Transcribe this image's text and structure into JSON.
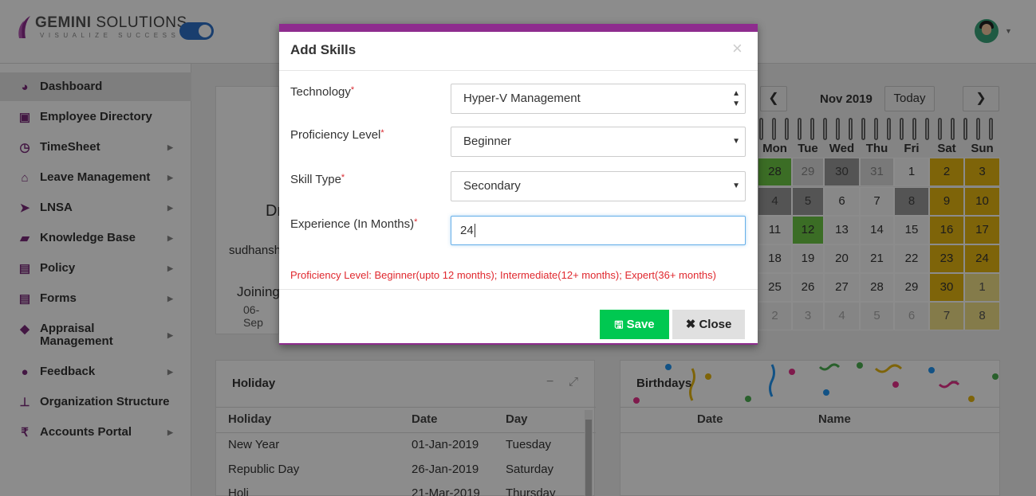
{
  "brand": {
    "name_bold": "GEMINI",
    "name_rest": " SOLUTIONS",
    "tagline": "VISUALIZE SUCCESS"
  },
  "sidebar": {
    "items": [
      {
        "label": "Dashboard",
        "icon": "dashboard-icon"
      },
      {
        "label": "Employee Directory",
        "icon": "contact-book-icon"
      },
      {
        "label": "TimeSheet",
        "icon": "clock-icon"
      },
      {
        "label": "Leave Management",
        "icon": "home-icon"
      },
      {
        "label": "LNSA",
        "icon": "paper-plane-icon"
      },
      {
        "label": "Knowledge Base",
        "icon": "folder-open-icon"
      },
      {
        "label": "Policy",
        "icon": "document-icon"
      },
      {
        "label": "Forms",
        "icon": "document-icon"
      },
      {
        "label": "Appraisal Management",
        "icon": "graduation-cap-icon"
      },
      {
        "label": "Feedback",
        "icon": "comments-icon"
      },
      {
        "label": "Organization Structure",
        "icon": "sitemap-icon"
      },
      {
        "label": "Accounts Portal",
        "icon": "rupee-icon"
      }
    ]
  },
  "profile": {
    "name_partial": "Dr",
    "email_partial": "sudhansh",
    "joining_label": "Joining",
    "joining_date": "06-Sep"
  },
  "calendar": {
    "month": "Nov 2019",
    "today_label": "Today",
    "days": [
      "Mon",
      "Tue",
      "Wed",
      "Thu",
      "Fri",
      "Sat",
      "Sun"
    ],
    "rows": [
      [
        {
          "d": "28",
          "s": "green"
        },
        {
          "d": "29",
          "s": "light"
        },
        {
          "d": "30",
          "s": "gray"
        },
        {
          "d": "31",
          "s": "light"
        },
        {
          "d": "1",
          "s": "norm"
        },
        {
          "d": "2",
          "s": "gold"
        },
        {
          "d": "3",
          "s": "gold"
        }
      ],
      [
        {
          "d": "4",
          "s": "gray"
        },
        {
          "d": "5",
          "s": "gray"
        },
        {
          "d": "6",
          "s": "norm"
        },
        {
          "d": "7",
          "s": "norm"
        },
        {
          "d": "8",
          "s": "gray"
        },
        {
          "d": "9",
          "s": "gold"
        },
        {
          "d": "10",
          "s": "gold"
        }
      ],
      [
        {
          "d": "11",
          "s": "norm"
        },
        {
          "d": "12",
          "s": "green"
        },
        {
          "d": "13",
          "s": "norm"
        },
        {
          "d": "14",
          "s": "norm"
        },
        {
          "d": "15",
          "s": "norm"
        },
        {
          "d": "16",
          "s": "gold"
        },
        {
          "d": "17",
          "s": "gold"
        }
      ],
      [
        {
          "d": "18",
          "s": "norm"
        },
        {
          "d": "19",
          "s": "norm"
        },
        {
          "d": "20",
          "s": "norm"
        },
        {
          "d": "21",
          "s": "norm"
        },
        {
          "d": "22",
          "s": "norm"
        },
        {
          "d": "23",
          "s": "gold"
        },
        {
          "d": "24",
          "s": "gold"
        }
      ],
      [
        {
          "d": "25",
          "s": "norm"
        },
        {
          "d": "26",
          "s": "norm"
        },
        {
          "d": "27",
          "s": "norm"
        },
        {
          "d": "28",
          "s": "norm"
        },
        {
          "d": "29",
          "s": "norm"
        },
        {
          "d": "30",
          "s": "gold"
        },
        {
          "d": "1",
          "s": "pale"
        }
      ],
      [
        {
          "d": "2",
          "s": "faded"
        },
        {
          "d": "3",
          "s": "faded"
        },
        {
          "d": "4",
          "s": "faded"
        },
        {
          "d": "5",
          "s": "faded"
        },
        {
          "d": "6",
          "s": "faded"
        },
        {
          "d": "7",
          "s": "pale"
        },
        {
          "d": "8",
          "s": "pale"
        }
      ]
    ]
  },
  "holiday": {
    "title": "Holiday",
    "columns": [
      "Holiday",
      "Date",
      "Day"
    ],
    "rows": [
      [
        "New Year",
        "01-Jan-2019",
        "Tuesday"
      ],
      [
        "Republic Day",
        "26-Jan-2019",
        "Saturday"
      ],
      [
        "Holi",
        "21-Mar-2019",
        "Thursday"
      ]
    ]
  },
  "birthdays": {
    "title": "Birthdays",
    "columns": [
      "Date",
      "Name"
    ]
  },
  "modal": {
    "title": "Add Skills",
    "fields": {
      "technology": {
        "label": "Technology",
        "value": "Hyper-V Management"
      },
      "proficiency": {
        "label": "Proficiency Level",
        "value": "Beginner"
      },
      "skill_type": {
        "label": "Skill Type",
        "value": "Secondary"
      },
      "experience": {
        "label": "Experience (In Months)",
        "value": "24"
      }
    },
    "required_mark": "*",
    "hint": "Proficiency Level: Beginner(upto 12 months); Intermediate(12+ months); Expert(36+ months)",
    "save_label": "Save",
    "close_label": "Close"
  },
  "colors": {
    "accent": "#8e2c8e",
    "save": "#00c851",
    "hint": "#e0282e",
    "toggle": "#2f72c8"
  }
}
